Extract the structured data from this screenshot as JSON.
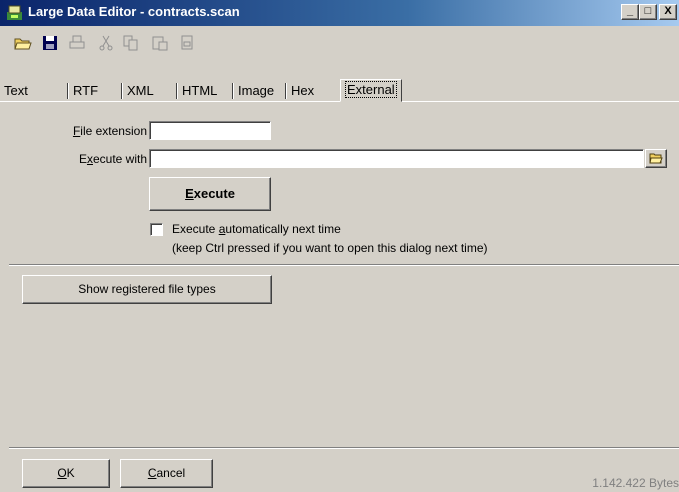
{
  "window": {
    "title": "Large Data Editor - contracts.scan",
    "minimize": "_",
    "maximize": "□",
    "close": "X"
  },
  "toolbar": {
    "items": [
      "open-icon",
      "save-icon",
      "print-icon",
      "cut-icon",
      "copy-icon",
      "paste-icon",
      "new-icon"
    ]
  },
  "tabs": [
    "Text",
    "RTF",
    "XML",
    "HTML",
    "Image",
    "Hex",
    "External"
  ],
  "active_tab": "External",
  "form": {
    "file_extension_label_u": "F",
    "file_extension_label_rest": "ile extension",
    "file_extension_value": "",
    "execute_with_label_a": "E",
    "execute_with_label_u": "x",
    "execute_with_label_rest": "ecute with",
    "execute_with_value": "",
    "execute_button_u": "E",
    "execute_button_rest": "xecute",
    "auto_label_a": "Execute ",
    "auto_label_u": "a",
    "auto_label_rest": "utomatically next time",
    "auto_checked": false,
    "auto_hint": "(keep Ctrl pressed if you want to open this dialog next time)",
    "show_types_button": "Show registered file types"
  },
  "footer": {
    "ok_u": "O",
    "ok_rest": "K",
    "cancel_u": "C",
    "cancel_rest": "ancel",
    "size": "1.142.422 Bytes"
  }
}
